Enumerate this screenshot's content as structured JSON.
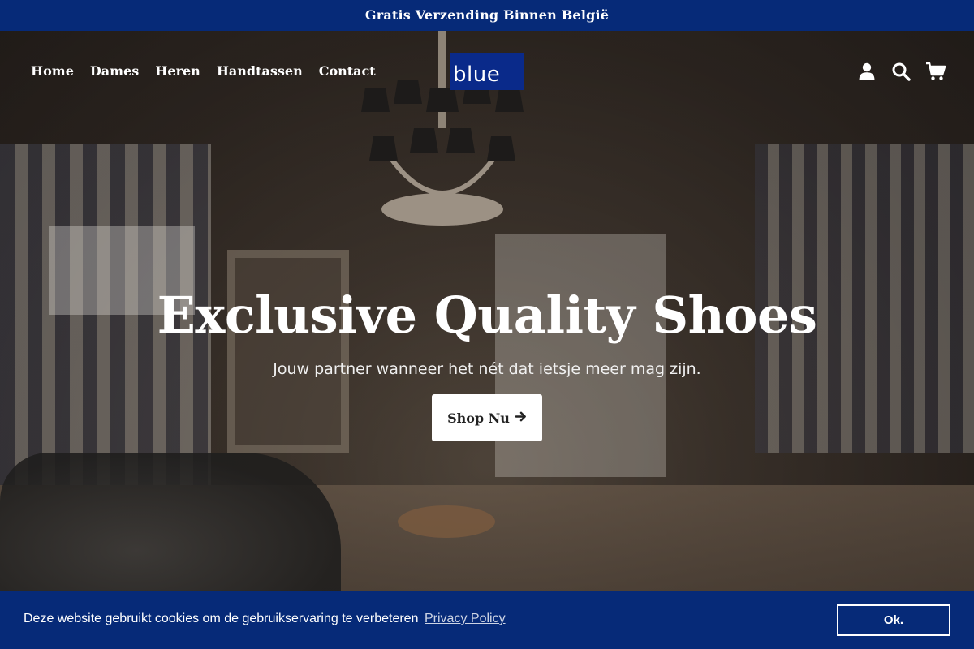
{
  "announcement": "Gratis Verzending Binnen België",
  "nav": {
    "items": [
      "Home",
      "Dames",
      "Heren",
      "Handtassen",
      "Contact"
    ]
  },
  "logo": {
    "text": "blue"
  },
  "header_icons": [
    "user-icon",
    "search-icon",
    "cart-icon"
  ],
  "hero": {
    "title": "Exclusive Quality Shoes",
    "subtitle": "Jouw partner wanneer het nét dat ietsje meer mag zijn.",
    "cta_label": "Shop Nu"
  },
  "cookie": {
    "message": "Deze website gebruikt cookies om de gebruikservaring te verbeteren",
    "policy_link": "Privacy Policy",
    "accept_label": "Ok."
  },
  "colors": {
    "brand_blue": "#062a78",
    "logo_blue": "#0a2a8a",
    "text_light": "#ffffff"
  }
}
